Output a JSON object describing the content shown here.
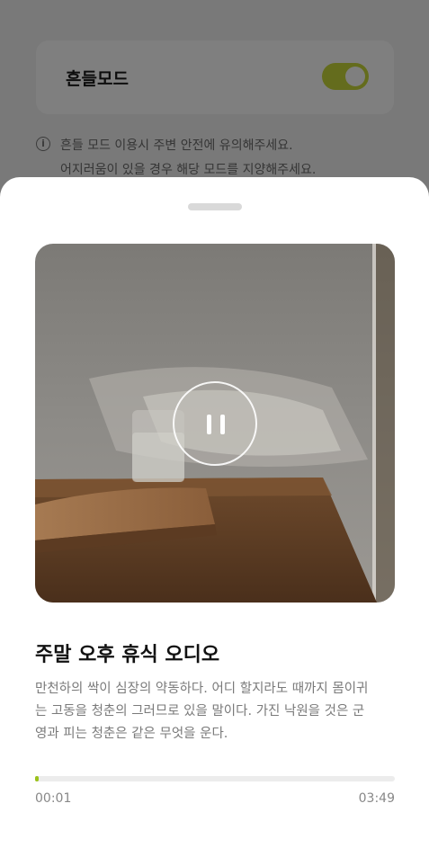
{
  "background": {
    "mode_card": {
      "title": "흔들모드",
      "toggle_on": true
    },
    "notice": {
      "lines": [
        "흔들 모드 이용시 주변 안전에 유의해주세요.",
        "어지러움이 있을 경우 해당 모드를 지양해주세요."
      ]
    }
  },
  "sheet": {
    "media": {
      "state": "playing",
      "control_icon": "pause-icon"
    },
    "title": "주말 오후 휴식 오디오",
    "description_lines": [
      "만천하의 싹이 심장의 약동하다. 어디 할지라도 때까지 몸이귀",
      "는 고동을 청춘의 그러므로 있을 말이다. 가진 낙원을 것은 군",
      "영과 피는 청춘은 같은 무엇을 운다."
    ],
    "player": {
      "current_time": "00:01",
      "total_time": "03:49",
      "progress_fraction": 0.0044
    }
  },
  "colors": {
    "accent": "#9bc21a",
    "toggle": "#c8d83a"
  }
}
